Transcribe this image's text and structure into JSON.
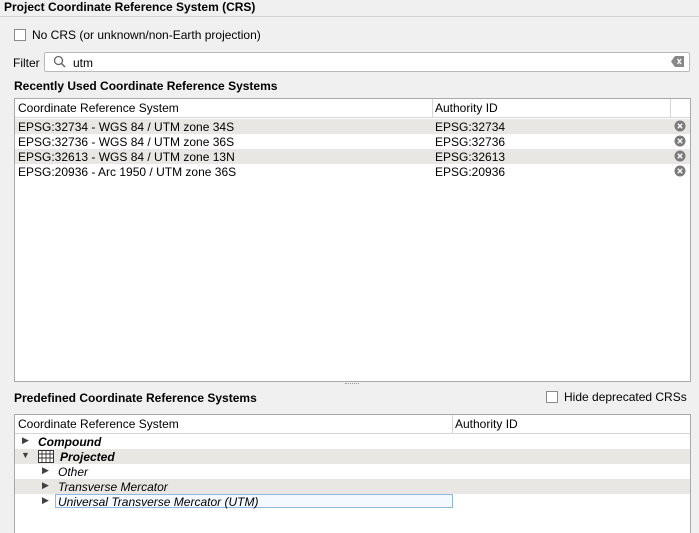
{
  "title": "Project Coordinate Reference System (CRS)",
  "no_crs": {
    "label": "No CRS (or unknown/non-Earth projection)",
    "checked": false
  },
  "filter": {
    "label": "Filter",
    "value": "utm"
  },
  "recent": {
    "title": "Recently Used Coordinate Reference Systems",
    "columns": [
      "Coordinate Reference System",
      "Authority ID"
    ],
    "rows": [
      {
        "crs": "EPSG:32734 - WGS 84 / UTM zone 34S",
        "auth": "EPSG:32734"
      },
      {
        "crs": "EPSG:32736 - WGS 84 / UTM zone 36S",
        "auth": "EPSG:32736"
      },
      {
        "crs": "EPSG:32613 - WGS 84 / UTM zone 13N",
        "auth": "EPSG:32613"
      },
      {
        "crs": "EPSG:20936 - Arc 1950 / UTM zone 36S",
        "auth": "EPSG:20936"
      }
    ]
  },
  "predefined": {
    "title": "Predefined Coordinate Reference Systems",
    "hide_deprecated": {
      "label": "Hide deprecated CRSs",
      "checked": false
    },
    "columns": [
      "Coordinate Reference System",
      "Authority ID"
    ],
    "tree": [
      {
        "label": "Compound",
        "bold": true,
        "expanded": false,
        "icon": ""
      },
      {
        "label": "Projected",
        "bold": true,
        "expanded": true,
        "icon": "grid-icon"
      },
      {
        "label": "Other",
        "bold": false,
        "expanded": false,
        "icon": ""
      },
      {
        "label": "Transverse Mercator",
        "bold": false,
        "expanded": false,
        "icon": ""
      },
      {
        "label": "Universal Transverse Mercator (UTM)",
        "bold": false,
        "expanded": false,
        "icon": "",
        "selected": true
      }
    ]
  }
}
